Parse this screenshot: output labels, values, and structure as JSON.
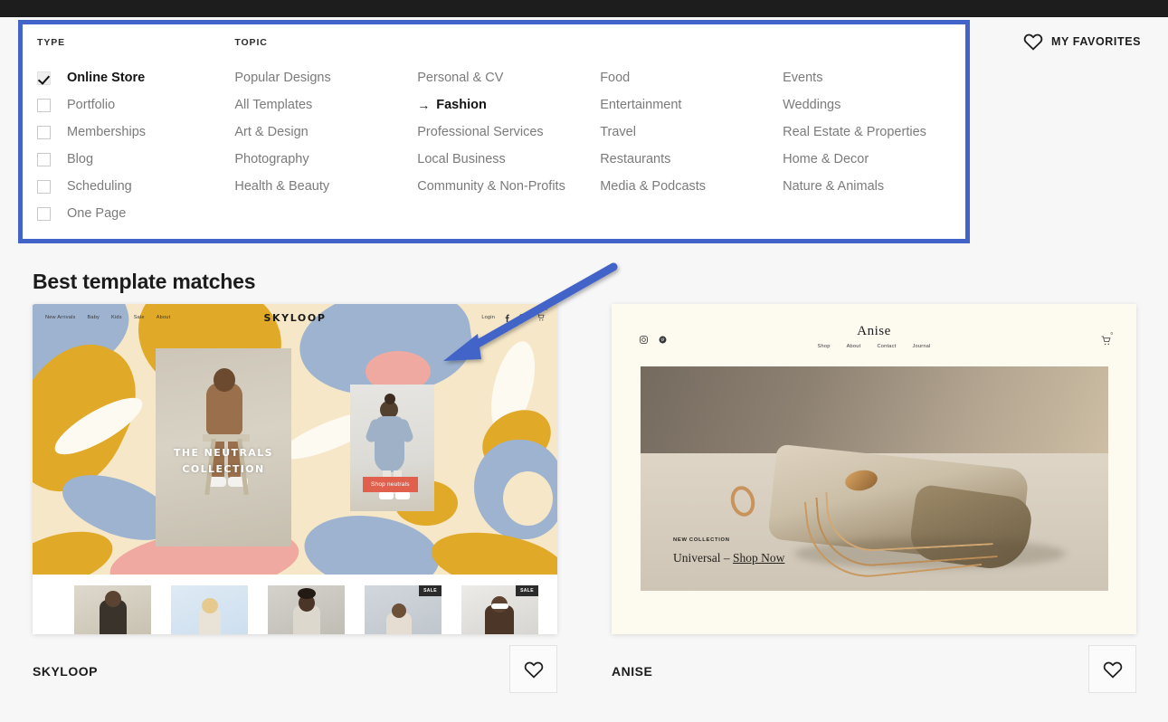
{
  "accent_blue": "#4263c7",
  "page_bg": "#f7f7f7",
  "topbar": {
    "color": "#1d1d1d"
  },
  "filters": {
    "type": {
      "heading": "TYPE",
      "items": [
        {
          "label": "Online Store",
          "checked": true
        },
        {
          "label": "Portfolio",
          "checked": false
        },
        {
          "label": "Memberships",
          "checked": false
        },
        {
          "label": "Blog",
          "checked": false
        },
        {
          "label": "Scheduling",
          "checked": false
        },
        {
          "label": "One Page",
          "checked": false
        }
      ]
    },
    "topic": {
      "heading": "TOPIC",
      "selected_arrow": "→",
      "columns": [
        [
          {
            "label": "Popular Designs",
            "selected": false
          },
          {
            "label": "All Templates",
            "selected": false
          },
          {
            "label": "Art & Design",
            "selected": false
          },
          {
            "label": "Photography",
            "selected": false
          },
          {
            "label": "Health & Beauty",
            "selected": false
          }
        ],
        [
          {
            "label": "Personal & CV",
            "selected": false
          },
          {
            "label": "Fashion",
            "selected": true
          },
          {
            "label": "Professional Services",
            "selected": false
          },
          {
            "label": "Local Business",
            "selected": false
          },
          {
            "label": "Community & Non-Profits",
            "selected": false
          }
        ],
        [
          {
            "label": "Food",
            "selected": false
          },
          {
            "label": "Entertainment",
            "selected": false
          },
          {
            "label": "Travel",
            "selected": false
          },
          {
            "label": "Restaurants",
            "selected": false
          },
          {
            "label": "Media & Podcasts",
            "selected": false
          }
        ],
        [
          {
            "label": "Events",
            "selected": false
          },
          {
            "label": "Weddings",
            "selected": false
          },
          {
            "label": "Real Estate & Properties",
            "selected": false
          },
          {
            "label": "Home & Decor",
            "selected": false
          },
          {
            "label": "Nature & Animals",
            "selected": false
          }
        ]
      ]
    }
  },
  "my_favorites": {
    "label": "MY FAVORITES",
    "icon": "heart-icon"
  },
  "results": {
    "heading": "Best template matches",
    "cards": [
      {
        "name": "SKYLOOP",
        "favorite_icon": "heart-outline-icon",
        "preview": {
          "logo": "SKYLOOP",
          "nav": [
            "New Arrivals",
            "Baby",
            "Kids",
            "Sale",
            "About"
          ],
          "right_nav": [
            "Login"
          ],
          "social_icons": [
            "facebook-icon",
            "instagram-icon"
          ],
          "cart_icon": "cart-icon",
          "cart_count": "0",
          "hero_title_line1": "THE NEUTRALS",
          "hero_title_line2": "COLLECTION",
          "cta": "Shop neutrals",
          "thumbnails": [
            {
              "badge": ""
            },
            {
              "badge": ""
            },
            {
              "badge": ""
            },
            {
              "badge": "SALE"
            },
            {
              "badge": "SALE"
            }
          ]
        }
      },
      {
        "name": "ANISE",
        "favorite_icon": "heart-outline-icon",
        "preview": {
          "logo": "Anise",
          "nav": [
            "Shop",
            "About",
            "Contact",
            "Journal"
          ],
          "social_icons": [
            "instagram-icon",
            "pinterest-icon"
          ],
          "cart_icon": "cart-icon",
          "cart_count": "0",
          "eyebrow": "NEW COLLECTION",
          "headline_prefix": "Universal – ",
          "headline_link": "Shop Now"
        }
      }
    ]
  },
  "annotation": {
    "arrow_color": "#4263c7",
    "type": "pointer-arrow"
  }
}
